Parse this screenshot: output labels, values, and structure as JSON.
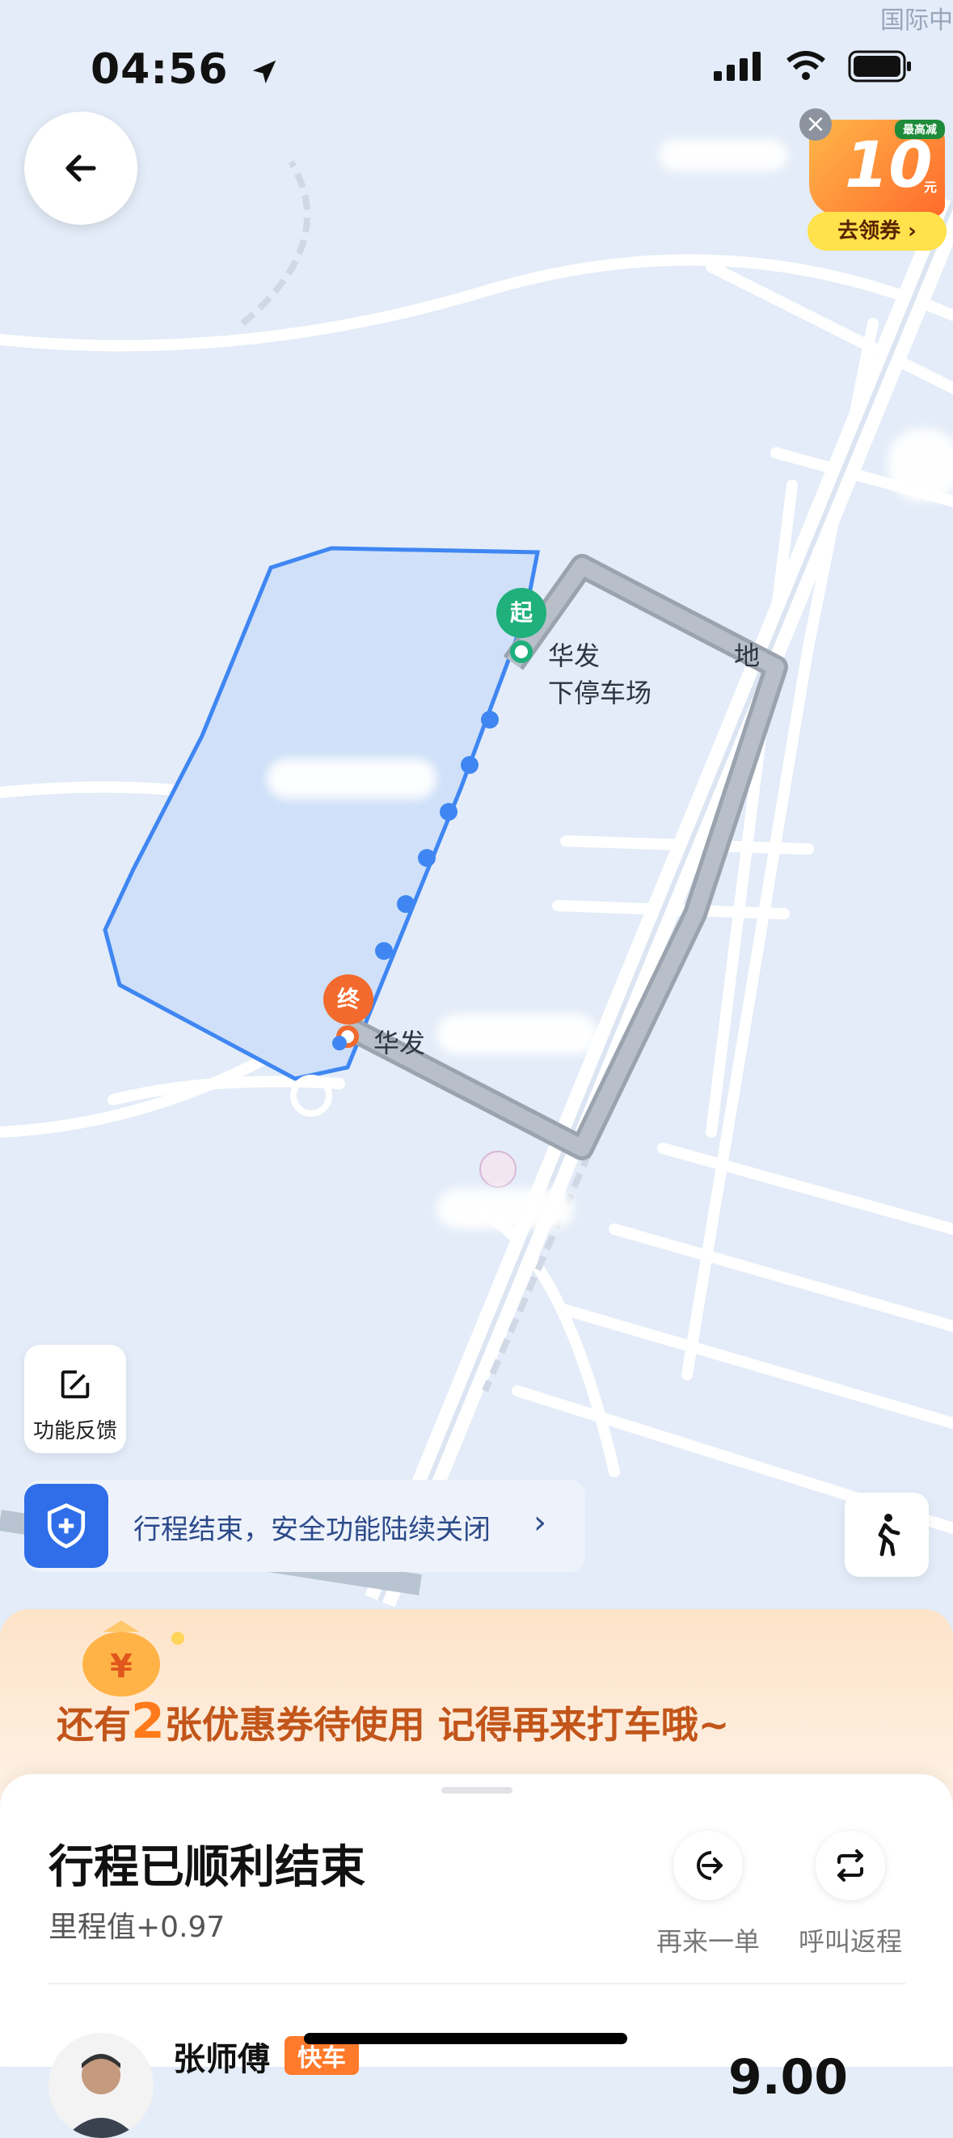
{
  "status_bar": {
    "time": "04:56",
    "corner_text": "国际中"
  },
  "map": {
    "start_pin": "起",
    "end_pin": "终",
    "start_label_line1": "华发",
    "start_label_line1_suffix": "地",
    "start_label_line2": "下停车场",
    "end_label": "华发"
  },
  "coupon_ad": {
    "badge": "最高减",
    "amount": "10",
    "unit": "元",
    "cta": "去领券 ›",
    "close": "×"
  },
  "feedback": {
    "label": "功能反馈"
  },
  "safety": {
    "text": "行程结束，安全功能陆续关闭",
    "chevron": "›"
  },
  "promo": {
    "prefix": "还有",
    "count": "2",
    "suffix": "张优惠券待使用 记得再来打车哦~"
  },
  "trip": {
    "title": "行程已顺利结束",
    "mileage": "里程值+0.97",
    "actions": [
      {
        "label": "再来一单"
      },
      {
        "label": "呼叫返程"
      }
    ]
  },
  "driver": {
    "name": "张师傅",
    "tag": "快车",
    "price": "9.00"
  },
  "colors": {
    "route_blue": "#3f86f2",
    "start_green": "#1fb07c",
    "end_orange": "#f26a2d",
    "accent_blue": "#2f6ee8"
  }
}
